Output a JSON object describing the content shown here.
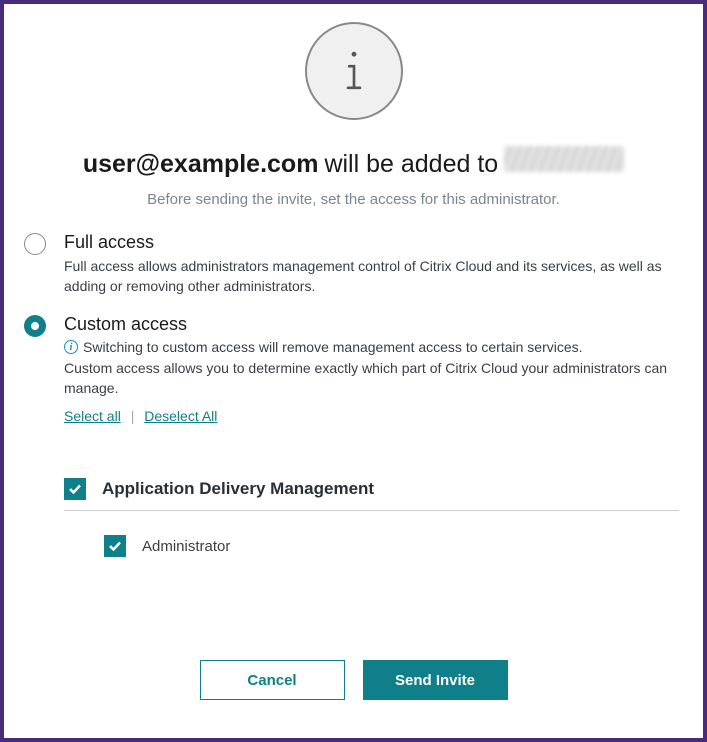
{
  "heading": {
    "user_email": "user@example.com",
    "middle_text": "will be added to"
  },
  "subheading": "Before sending the invite, set the access for this administrator.",
  "access": {
    "full": {
      "title": "Full access",
      "desc": "Full access allows administrators management control of Citrix Cloud and its services, as well as adding or removing other administrators."
    },
    "custom": {
      "title": "Custom access",
      "warning": "Switching to custom access will remove management access to certain services.",
      "desc": "Custom access allows you to determine exactly which part of Citrix Cloud your administrators can manage.",
      "select_all": "Select all",
      "deselect_all": "Deselect All"
    }
  },
  "permissions": {
    "section1": {
      "label": "Application Delivery Management",
      "child1": "Administrator"
    }
  },
  "buttons": {
    "cancel": "Cancel",
    "send_invite": "Send Invite"
  }
}
